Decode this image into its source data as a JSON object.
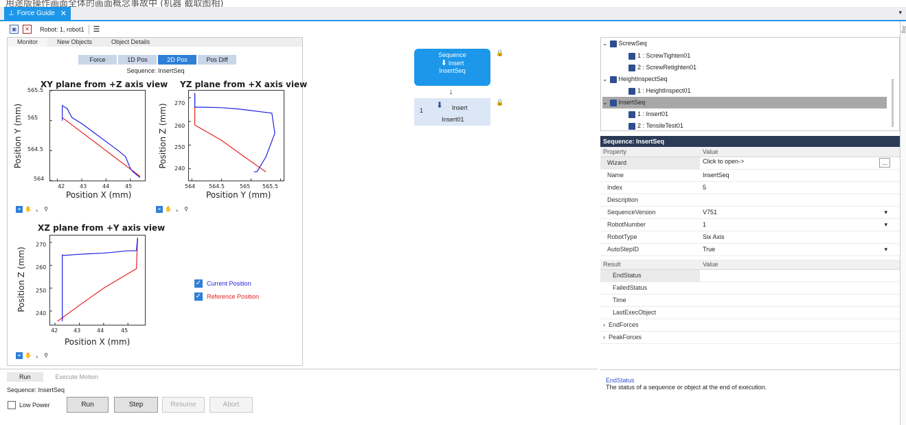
{
  "window": {
    "top_strip_text": "用途版操作画面全体的画面概念事故中 (机器 截取图相)",
    "document_tab": "Force Guide",
    "right_edge_label": "Jog"
  },
  "toolbar": {
    "robot_label": "Robot: 1, robot1"
  },
  "left_panel": {
    "tabs": [
      "Monitor",
      "New Objects",
      "Object Details"
    ],
    "view_tabs": [
      "Force",
      "1D Pos",
      "2D Pos",
      "Pos Diff"
    ],
    "selected_view": "2D Pos",
    "sequence_caption": "Sequence: InsertSeq",
    "legend": [
      "Current Position",
      "Reference Position"
    ]
  },
  "colors": {
    "current": "#1f1fe0",
    "reference": "#e82020",
    "accent": "#1c97ea",
    "selected_tab": "#2f7fd6"
  },
  "chart_data": [
    {
      "type": "line",
      "title": "XY plane from +Z axis view",
      "xlabel": "Position X (mm)",
      "ylabel": "Position Y (mm)",
      "xlim": [
        41.7,
        45.6
      ],
      "ylim": [
        564.0,
        565.5
      ],
      "xticks": [
        "42",
        "43",
        "44",
        "45"
      ],
      "yticks": [
        "564",
        "564.5",
        "565",
        "565.5"
      ],
      "series": [
        {
          "name": "Current Position",
          "color": "#1f1fe0",
          "x": [
            42.2,
            42.2,
            42.4,
            42.6,
            43.0,
            43.5,
            44.0,
            44.5,
            44.8,
            45.0,
            45.1,
            45.4
          ],
          "y": [
            565.0,
            565.25,
            565.2,
            565.05,
            564.95,
            564.8,
            564.65,
            564.5,
            564.4,
            564.2,
            564.15,
            564.05
          ]
        },
        {
          "name": "Reference Position",
          "color": "#e82020",
          "x": [
            42.2,
            45.4
          ],
          "y": [
            565.05,
            564.07
          ]
        }
      ]
    },
    {
      "type": "line",
      "title": "YZ plane from +X axis view",
      "xlabel": "Position Y (mm)",
      "ylabel": "Position Z (mm)",
      "xlim": [
        563.95,
        565.55
      ],
      "ylim": [
        235,
        273
      ],
      "xticks": [
        "564",
        "564.5",
        "565",
        "565.5"
      ],
      "yticks": [
        "240",
        "250",
        "260",
        "270"
      ],
      "series": [
        {
          "name": "Current Position",
          "color": "#1f1fe0",
          "x": [
            564.05,
            564.05,
            564.2,
            564.5,
            564.8,
            565.0,
            565.35,
            565.4,
            565.25,
            565.1,
            565.05
          ],
          "y": [
            272,
            266,
            266,
            265.8,
            265.2,
            264.6,
            263.5,
            255,
            245,
            238.7,
            238.7
          ]
        },
        {
          "name": "Reference Position",
          "color": "#e82020",
          "x": [
            564.05,
            564.05,
            564.5,
            565.0,
            565.25
          ],
          "y": [
            272,
            258.5,
            252,
            243,
            238.7
          ]
        }
      ]
    },
    {
      "type": "line",
      "title": "XZ plane from +Y axis view",
      "xlabel": "Position X (mm)",
      "ylabel": "Position Z (mm)",
      "xlim": [
        41.8,
        45.7
      ],
      "ylim": [
        234,
        273
      ],
      "xticks": [
        "42",
        "43",
        "44",
        "45"
      ],
      "yticks": [
        "240",
        "250",
        "260",
        "270"
      ],
      "series": [
        {
          "name": "Current Position",
          "color": "#1f1fe0",
          "x": [
            42.3,
            42.3,
            42.4,
            43.0,
            44.0,
            45.0,
            45.3,
            45.35,
            45.4
          ],
          "y": [
            235.5,
            264.5,
            264.3,
            264.8,
            265.3,
            266.3,
            266.3,
            266.5,
            272
          ]
        },
        {
          "name": "Reference Position",
          "color": "#e82020",
          "x": [
            42.1,
            43.0,
            44.0,
            45.35,
            45.4
          ],
          "y": [
            235.5,
            242.5,
            250,
            258.5,
            272
          ]
        }
      ]
    }
  ],
  "flow": {
    "sequence_box": {
      "title": "Sequence",
      "icon_label": "Insert",
      "name": "InsertSeq"
    },
    "object_box": {
      "index": "1",
      "icon_label": "Insert",
      "name": "Insert01"
    }
  },
  "tree": [
    {
      "indent": 0,
      "label": "ScrewSeq",
      "expanded": true
    },
    {
      "indent": 1,
      "label": "1 :  ScrewTighten01"
    },
    {
      "indent": 1,
      "label": "2 :  ScrewRetighten01"
    },
    {
      "indent": 0,
      "label": "HeightInspectSeq",
      "expanded": true
    },
    {
      "indent": 1,
      "label": "1 :  HeightInspect01"
    },
    {
      "indent": 0,
      "label": "InsertSeq",
      "expanded": true,
      "selected": true
    },
    {
      "indent": 1,
      "label": "1 :  Insert01"
    },
    {
      "indent": 1,
      "label": "2 :  TensileTest01"
    }
  ],
  "properties": {
    "header": "Sequence: InsertSeq",
    "columns": [
      "Property",
      "Value"
    ],
    "rows": [
      {
        "key": "Wizard",
        "value": "Click to open->",
        "button": "..."
      },
      {
        "key": "Name",
        "value": "InsertSeq"
      },
      {
        "key": "Index",
        "value": "5"
      },
      {
        "key": "Description",
        "value": ""
      },
      {
        "key": "SequenceVersion",
        "value": "V751",
        "dropdown": true
      },
      {
        "key": "RobotNumber",
        "value": "1",
        "dropdown": true
      },
      {
        "key": "RobotType",
        "value": "Six Axis"
      },
      {
        "key": "AutoStepID",
        "value": "True",
        "dropdown": true
      }
    ]
  },
  "results": {
    "columns": [
      "Result",
      "Value"
    ],
    "rows": [
      {
        "key": "EndStatus",
        "value": ""
      },
      {
        "key": "FailedStatus",
        "value": ""
      },
      {
        "key": "Time",
        "value": ""
      },
      {
        "key": "LastExecObject",
        "value": ""
      },
      {
        "key": "EndForces",
        "value": "",
        "expander": true
      },
      {
        "key": "PeakForces",
        "value": "",
        "expander": true
      }
    ]
  },
  "description": {
    "title": "EndStatus",
    "text": "The status of a sequence or object at the end of execution."
  },
  "bottom": {
    "tabs": [
      "Run",
      "Execute Motion"
    ],
    "sequence_label": "Sequence: InsertSeq",
    "low_power_label": "Low Power",
    "buttons": [
      "Run",
      "Step",
      "Resume",
      "Abort"
    ]
  }
}
